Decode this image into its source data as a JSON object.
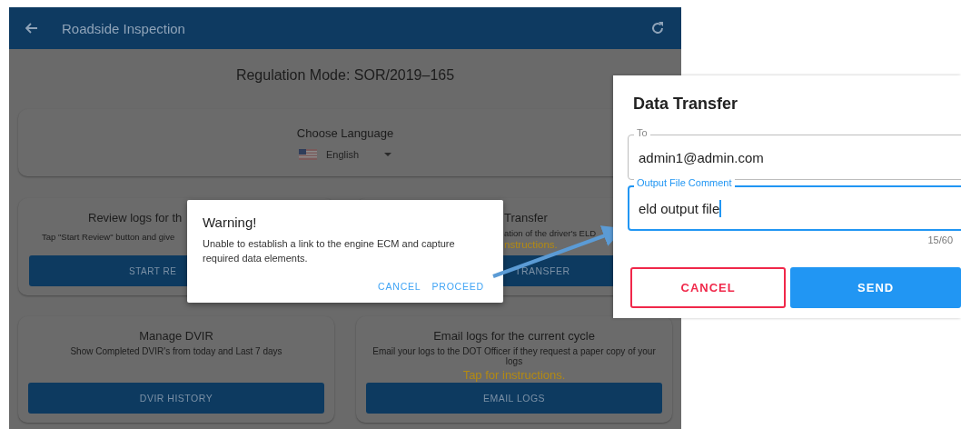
{
  "app_bar": {
    "title": "Roadside Inspection"
  },
  "regulation_mode": "Regulation Mode: SOR/2019–165",
  "language_card": {
    "title": "Choose Language",
    "selected_language": "English"
  },
  "cards": [
    {
      "kind": "cut_end",
      "title": "Review logs for th",
      "description": "Tap \"Start Review\" button and give",
      "button": "START RE"
    },
    {
      "kind": "cut_start",
      "title": "Transfer",
      "description": "ation of the driver's ELD",
      "link": "nstructions.",
      "button": "TRANSFER"
    },
    {
      "kind": "full",
      "title": "Manage DVIR",
      "description": "Show Completed DVIR's from today and Last 7 days",
      "button": "DVIR HISTORY"
    },
    {
      "kind": "full",
      "title": "Email logs for the current cycle",
      "description": "Email your logs to the DOT Officer if they request a paper copy of your logs",
      "link": "Tap for instructions.",
      "button": "EMAIL LOGS"
    }
  ],
  "warning_dialog": {
    "title": "Warning!",
    "message": "Unable to establish a link to the engine ECM and capture required data elements.",
    "buttons": [
      "CANCEL",
      "PROCEED"
    ]
  },
  "data_transfer": {
    "title": "Data Transfer",
    "fields": [
      {
        "label": "To",
        "value": "admin1@admin.com",
        "focused": false
      },
      {
        "label": "Output File Comment",
        "value": "eld output file",
        "focused": true
      }
    ],
    "counter": "15/60",
    "cancel": "CANCEL",
    "send": "SEND"
  }
}
